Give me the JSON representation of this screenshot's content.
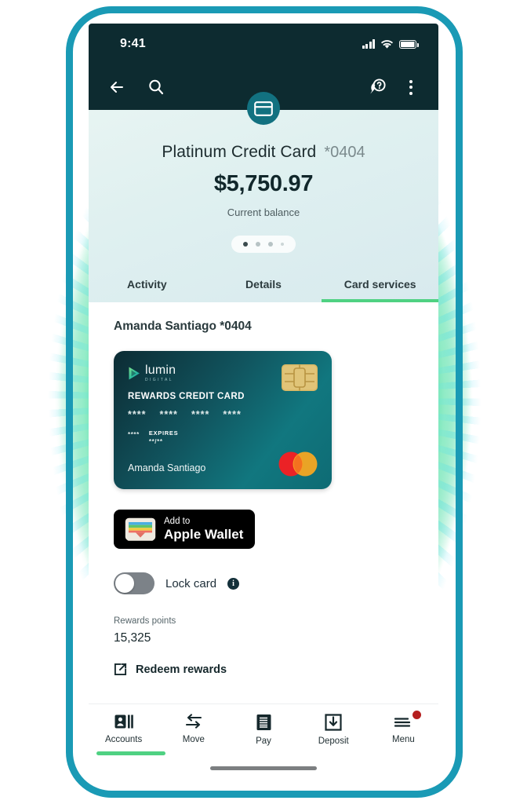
{
  "status_bar": {
    "time": "9:41",
    "signal_icon": "cellular-signal-icon",
    "wifi_icon": "wifi-icon",
    "battery_icon": "battery-icon"
  },
  "nav_bar": {
    "back_icon": "back-arrow-icon",
    "search_icon": "search-icon",
    "center_icon": "credit-card-icon",
    "help_icon": "help-chat-icon",
    "overflow_icon": "kebab-menu-icon"
  },
  "hero": {
    "title": "Platinum Credit Card",
    "masked_number": "*0404",
    "balance": "$5,750.97",
    "balance_label": "Current balance",
    "pagination": {
      "total": 4,
      "active_index": 0
    }
  },
  "tabs": [
    {
      "label": "Activity",
      "active": false
    },
    {
      "label": "Details",
      "active": false
    },
    {
      "label": "Card services",
      "active": true
    }
  ],
  "account": {
    "heading": "Amanda Santiago *0404"
  },
  "credit_card": {
    "brand_name": "lumin",
    "brand_sub": "DIGITAL",
    "product": "REWARDS CREDIT CARD",
    "number_groups": [
      "****",
      "****",
      "****",
      "****"
    ],
    "cvv_mask": "****",
    "expires_label": "EXPIRES",
    "expires_value": "**/**",
    "holder": "Amanda Santiago",
    "network_icon": "mastercard-logo-icon",
    "chip_icon": "emv-chip-icon",
    "gradient_from": "#0c2b33",
    "gradient_to": "#0e6b74"
  },
  "wallet_button": {
    "line1": "Add to",
    "line2": "Apple Wallet",
    "icon": "apple-wallet-icon"
  },
  "lock_card": {
    "label": "Lock card",
    "enabled": false,
    "info_icon": "info-icon",
    "info_glyph": "i"
  },
  "rewards": {
    "label": "Rewards points",
    "value": "15,325",
    "redeem_label": "Redeem rewards",
    "redeem_icon": "external-link-icon"
  },
  "bottom_nav": {
    "items": [
      {
        "label": "Accounts",
        "icon": "accounts-icon",
        "active": true,
        "badge": false
      },
      {
        "label": "Move",
        "icon": "transfer-icon",
        "active": false,
        "badge": false
      },
      {
        "label": "Pay",
        "icon": "bill-pay-icon",
        "active": false,
        "badge": false
      },
      {
        "label": "Deposit",
        "icon": "deposit-icon",
        "active": false,
        "badge": false
      },
      {
        "label": "Menu",
        "icon": "hamburger-menu-icon",
        "active": false,
        "badge": true
      }
    ]
  },
  "theme": {
    "header_dark": "#0d2b30",
    "accent_green": "#4fd182",
    "badge_red": "#b51f1f",
    "frame_teal": "#1a9ab5"
  }
}
